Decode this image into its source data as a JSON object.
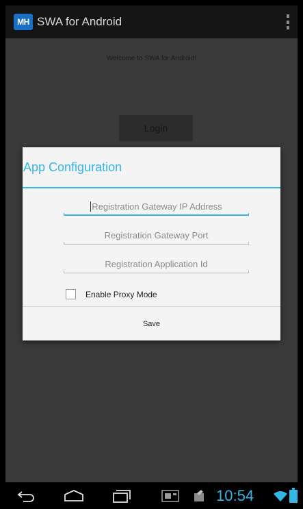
{
  "actionbar": {
    "icon_text": "MH",
    "title": "SWA for Android",
    "overflow_icon": "overflow-menu-icon"
  },
  "main": {
    "welcome_text": "Welcome to SWA for Android!",
    "login_label": "Login"
  },
  "dialog": {
    "title": "App Configuration",
    "fields": [
      {
        "placeholder": "Registration Gateway IP Address",
        "value": ""
      },
      {
        "placeholder": "Registration Gateway Port",
        "value": ""
      },
      {
        "placeholder": "Registration Application Id",
        "value": ""
      }
    ],
    "checkbox_label": "Enable Proxy Mode",
    "checkbox_checked": false,
    "save_label": "Save"
  },
  "navbar": {
    "time": "10:54",
    "icons": [
      "back-icon",
      "home-icon",
      "recents-icon",
      "screenshot-icon",
      "notification-icon",
      "wifi-icon",
      "battery-icon"
    ]
  },
  "colors": {
    "accent": "#33b5e5",
    "dialog_bg": "#f4f4f4",
    "actionbar_bg": "#151515"
  }
}
